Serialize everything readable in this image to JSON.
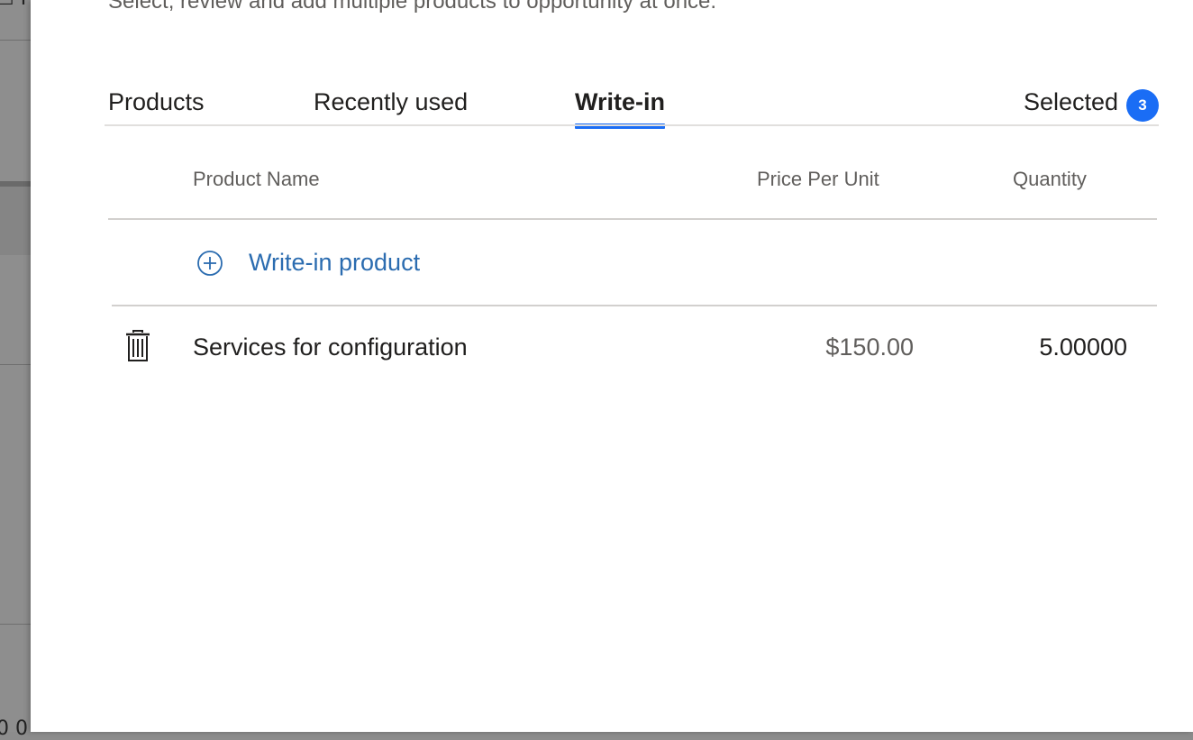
{
  "background": {
    "glyph_top": "☐ I",
    "glyph_bottom": "0 0"
  },
  "dialog": {
    "subtitle": "Select, review and add multiple products to opportunity at once."
  },
  "tabs": [
    {
      "label": "Products",
      "active": false
    },
    {
      "label": "Recently used",
      "active": false
    },
    {
      "label": "Write-in",
      "active": true
    }
  ],
  "selected": {
    "label": "Selected",
    "count": "3",
    "badge_color": "#1a6df5"
  },
  "table": {
    "columns": [
      "Product Name",
      "Price Per Unit",
      "Quantity"
    ],
    "write_in_label": "Write-in product",
    "rows": [
      {
        "name": "Services for configuration",
        "price": "$150.00",
        "quantity": "5.00000",
        "delete_icon": "trash-icon"
      }
    ]
  },
  "colors": {
    "accent": "#1a6df5",
    "link": "#2b6cb0"
  }
}
